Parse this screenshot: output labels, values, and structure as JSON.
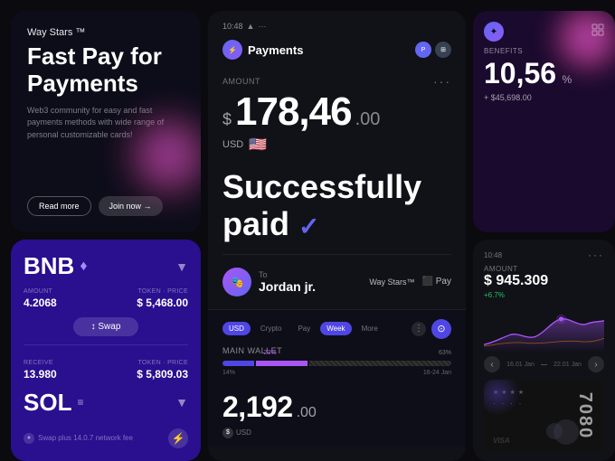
{
  "app": {
    "name": "Way Stars",
    "tagline": "™"
  },
  "hero": {
    "title": "Fast Pay for Payments",
    "description": "Web3 community for easy and fast payments methods with wide range of personal customizable cards!",
    "btn_readmore": "Read more",
    "btn_join": "Join now →"
  },
  "payment": {
    "status_time": "10:48",
    "section_label": "Payments",
    "amount_label": "AMOUNT",
    "amount_main": "178,46",
    "amount_cents": ".00",
    "currency": "USD",
    "success_line1": "Successfully",
    "success_line2": "paid",
    "to_label": "To",
    "recipient": "Jordan jr.",
    "method1": "Way Stars™",
    "method2": "⬛ Pay"
  },
  "wallet": {
    "tabs": [
      "USD",
      "Crypto",
      "Pay",
      "Week",
      "More"
    ],
    "active_tab": "USD",
    "active_tab2": "Week",
    "wallet_label": "MAIN WALLET",
    "prog_seg1": "14%",
    "prog_seg2": "23%",
    "prog_seg3": "63%",
    "balance_main": "2,192",
    "balance_cents": ".00",
    "currency_badge": "USD",
    "date_range": "16-24 Jan"
  },
  "swap": {
    "coin1": "BNB",
    "coin1_icon": "♦",
    "coin2": "SOL",
    "coin2_icon": "≡",
    "amount_label": "AMOUNT",
    "token1_label": "TOKEN · PRICE",
    "amount1": "4.2068",
    "price1": "$ 5,468.00",
    "receive_label": "RECEIVE",
    "token2_label": "TOKEN · PRICE",
    "amount2": "13.980",
    "price2": "$ 5,809.03",
    "swap_btn": "↕ Swap",
    "fee_text": "Swap plus 14.0.7 network fee"
  },
  "benefits": {
    "label": "BENEFITS",
    "amount": "10,56",
    "percent_symbol": "%",
    "sub_amount": "+ $45,698.00"
  },
  "chart": {
    "time": "10:48",
    "label": "AMOUNT",
    "amount": "$ 945.309",
    "change": "+6.7%",
    "date_from": "16.01 Jan",
    "date_to": "22.01 Jan"
  },
  "credit_card": {
    "stars": "★★★★",
    "number_partial": "7080",
    "card_type": "VISA"
  }
}
